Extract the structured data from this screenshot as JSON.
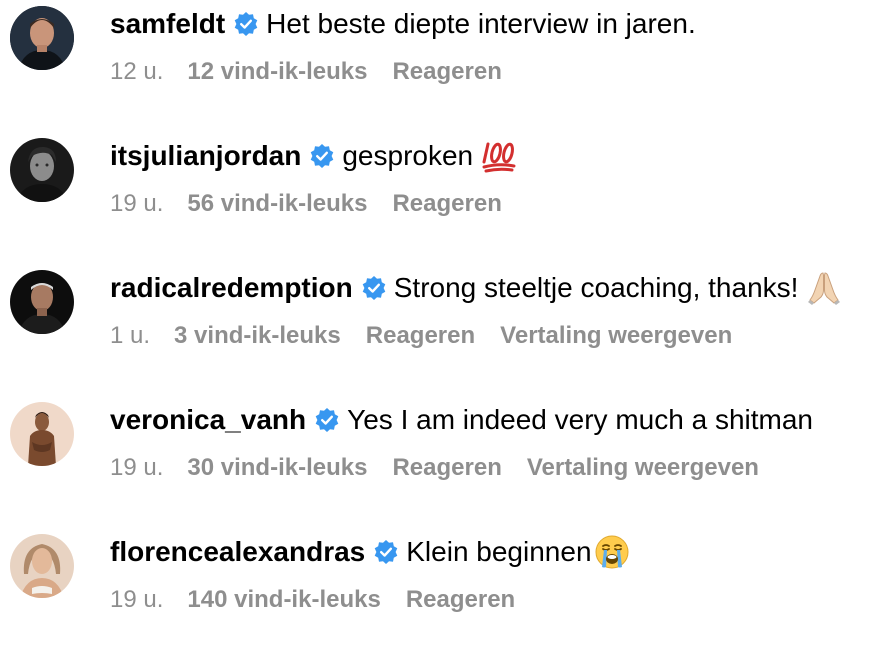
{
  "colors": {
    "text": "#000000",
    "meta": "#8e8e8e",
    "verified_badge": "#3897f0"
  },
  "comments": [
    {
      "username": "samfeldt",
      "text": "Het beste diepte interview in jaren.",
      "emoji": "",
      "time": "12 u.",
      "likes": "12 vind-ik-leuks",
      "reply": "Reageren",
      "translate": "",
      "avatar_icon": "profile-photo"
    },
    {
      "username": "itsjulianjordan",
      "text": "gesproken",
      "emoji": "hundred-points-emoji",
      "time": "19 u.",
      "likes": "56 vind-ik-leuks",
      "reply": "Reageren",
      "translate": "",
      "avatar_icon": "profile-photo"
    },
    {
      "username": "radicalredemption",
      "text": "Strong steeltje coaching, thanks!",
      "emoji": "folded-hands-emoji",
      "time": "1 u.",
      "likes": "3 vind-ik-leuks",
      "reply": "Reageren",
      "translate": "Vertaling weergeven",
      "avatar_icon": "profile-photo"
    },
    {
      "username": "veronica_vanh",
      "text": "Yes I am indeed very much a shitman",
      "emoji": "",
      "time": "19 u.",
      "likes": "30 vind-ik-leuks",
      "reply": "Reageren",
      "translate": "Vertaling weergeven",
      "avatar_icon": "profile-photo"
    },
    {
      "username": "florencealexandras",
      "text": "Klein beginnen",
      "emoji": "loudly-crying-face-emoji",
      "time": "19 u.",
      "likes": "140 vind-ik-leuks",
      "reply": "Reageren",
      "translate": "",
      "avatar_icon": "profile-photo"
    }
  ]
}
